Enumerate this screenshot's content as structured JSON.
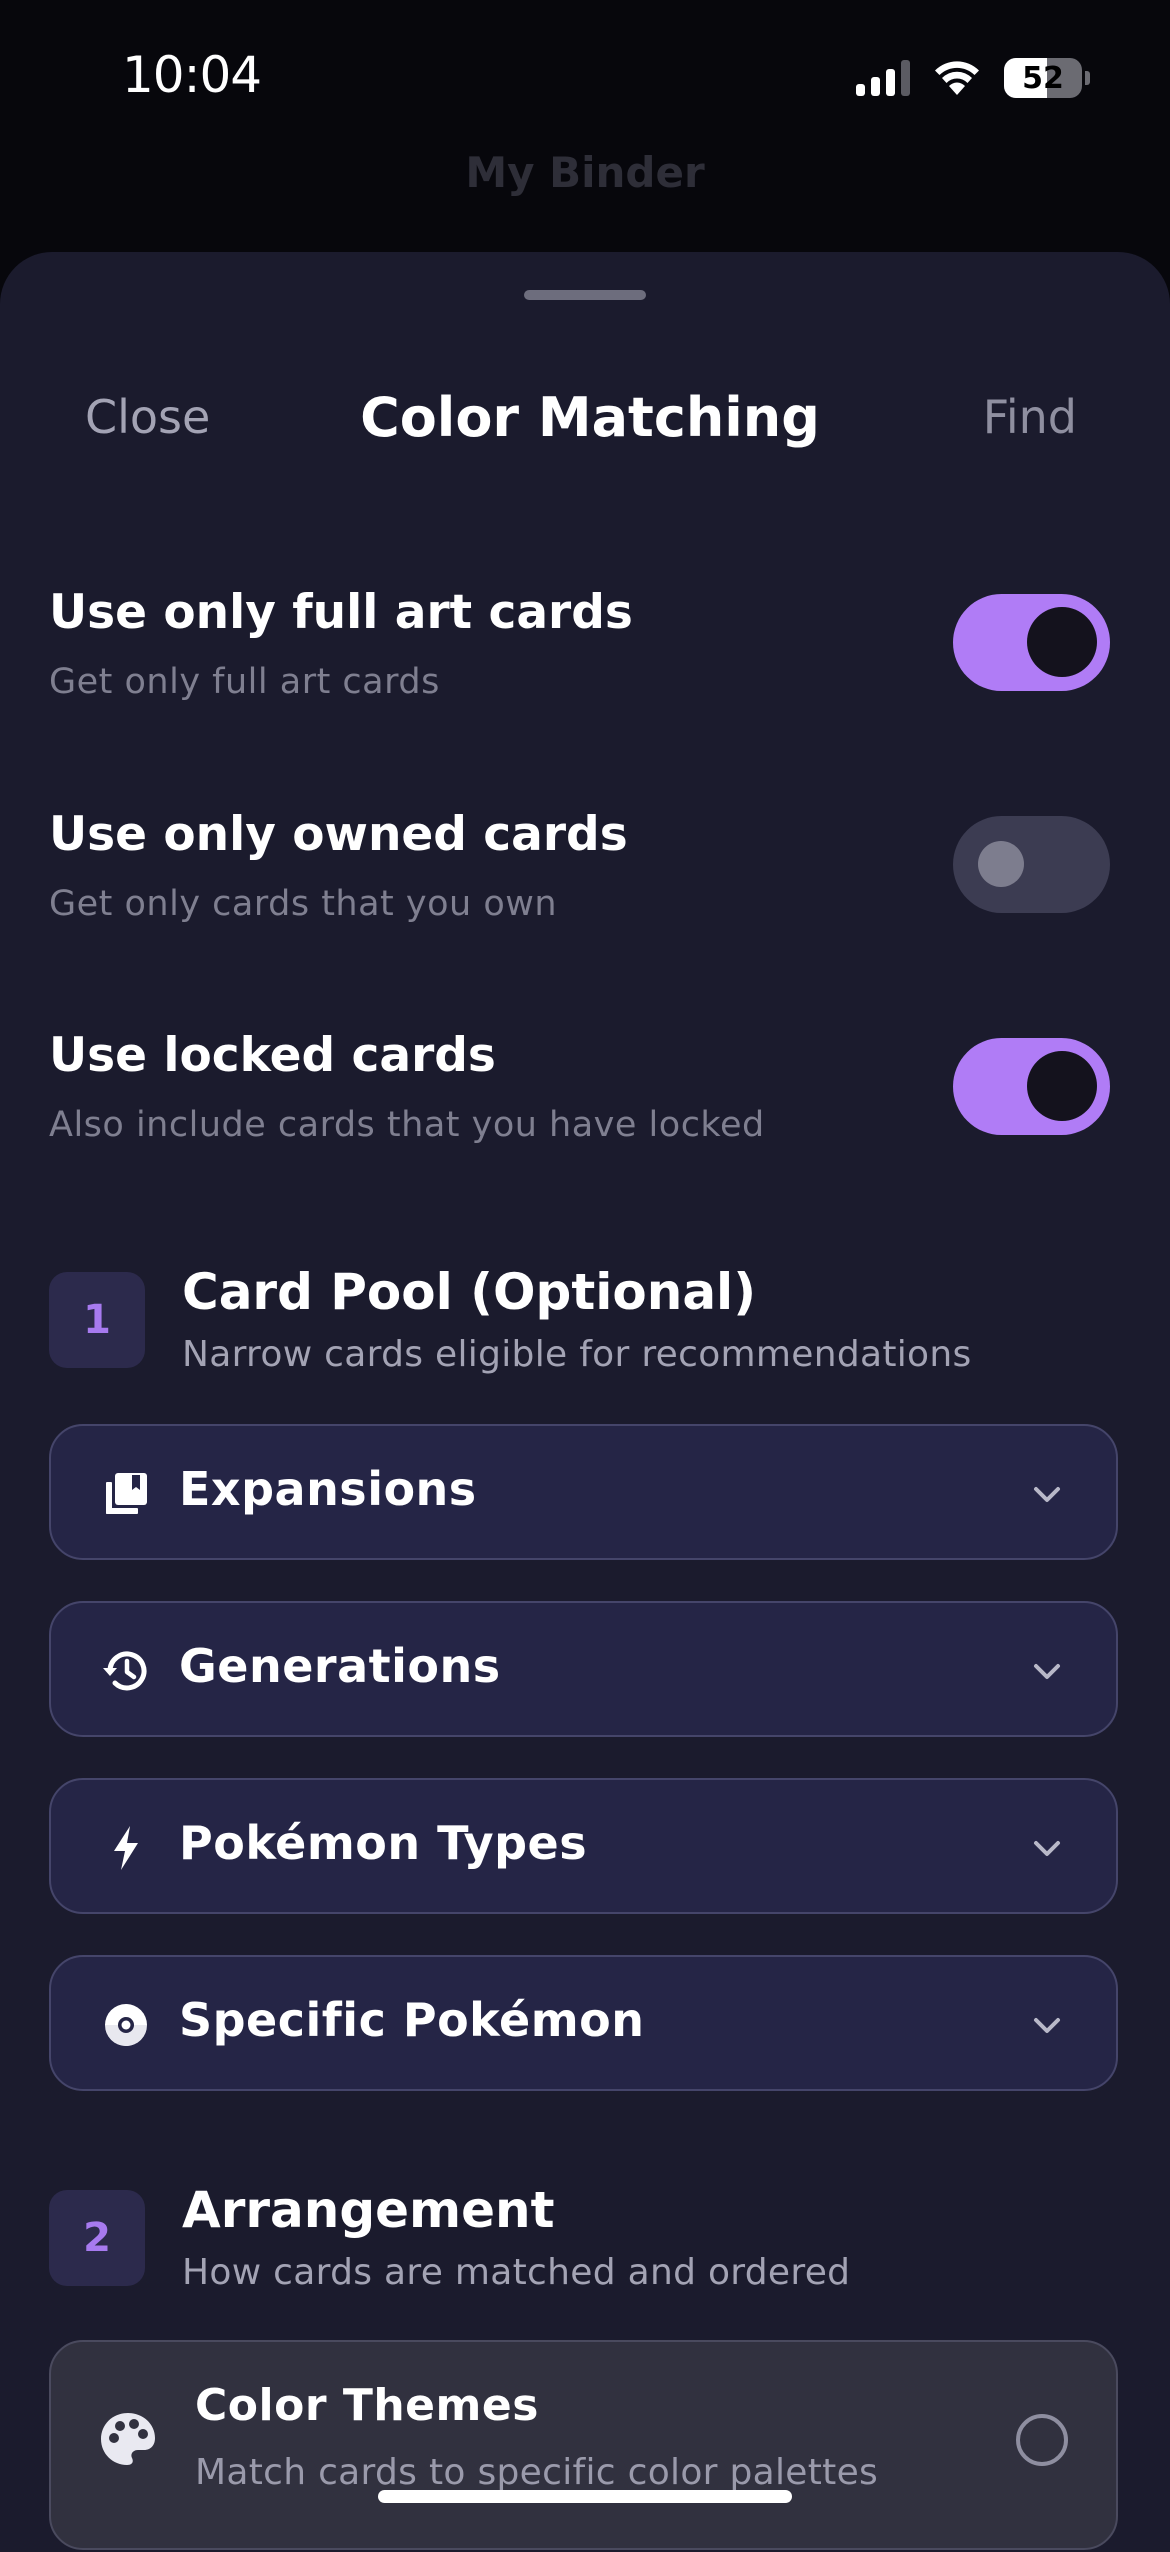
{
  "status_bar": {
    "time": "10:04",
    "battery": "52"
  },
  "background": {
    "title": "My Binder"
  },
  "nav": {
    "close_label": "Close",
    "title": "Color Matching",
    "find_label": "Find"
  },
  "options": [
    {
      "title": "Use only full art cards",
      "subtitle": "Get only full art cards",
      "enabled": true
    },
    {
      "title": "Use only owned cards",
      "subtitle": "Get only cards that you own",
      "enabled": false
    },
    {
      "title": "Use locked cards",
      "subtitle": "Also include cards that you have locked",
      "enabled": true
    }
  ],
  "sections": [
    {
      "number": "1",
      "title": "Card Pool (Optional)",
      "subtitle": "Narrow cards eligible for recommendations"
    },
    {
      "number": "2",
      "title": "Arrangement",
      "subtitle": "How cards are matched and ordered"
    }
  ],
  "filters": [
    {
      "label": "Expansions",
      "icon": "collection-icon"
    },
    {
      "label": "Generations",
      "icon": "history-icon"
    },
    {
      "label": "Pokémon Types",
      "icon": "bolt-icon"
    },
    {
      "label": "Specific Pokémon",
      "icon": "pokeball-icon"
    }
  ],
  "arrangement_options": [
    {
      "title": "Color Themes",
      "subtitle": "Match cards to specific color palettes",
      "icon": "palette-icon",
      "selected": false
    }
  ],
  "colors": {
    "accent": "#b07cf6",
    "sheet": "#1b1b2d",
    "pill": "#252546"
  }
}
